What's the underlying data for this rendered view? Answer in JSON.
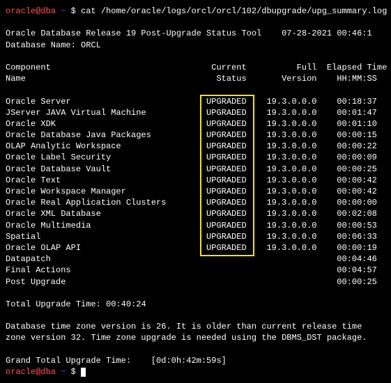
{
  "prompt": {
    "user": "oracle@dba",
    "tilde": "~",
    "dollar": "$",
    "command": "cat /home/oracle/logs/orcl/orcl/102/dbupgrade/upg_summary.log"
  },
  "header_line1_left": "Oracle Database Release 19 Post-Upgrade Status Tool",
  "header_line1_right": "07-28-2021 00:46:1",
  "db_name_label": "Database Name: ORCL",
  "col": {
    "c1a": "Component",
    "c1b": "Name",
    "c2a": "Current",
    "c2b": "Status",
    "c3a": "Full",
    "c3b": "Version",
    "c4a": "Elapsed Time",
    "c4b": "HH:MM:SS"
  },
  "rows": [
    {
      "name": "Oracle Server",
      "status": "UPGRADED",
      "ver": "19.3.0.0.0",
      "time": "00:18:37"
    },
    {
      "name": "JServer JAVA Virtual Machine",
      "status": "UPGRADED",
      "ver": "19.3.0.0.0",
      "time": "00:01:47"
    },
    {
      "name": "Oracle XDK",
      "status": "UPGRADED",
      "ver": "19.3.0.0.0",
      "time": "00:01:10"
    },
    {
      "name": "Oracle Database Java Packages",
      "status": "UPGRADED",
      "ver": "19.3.0.0.0",
      "time": "00:00:15"
    },
    {
      "name": "OLAP Analytic Workspace",
      "status": "UPGRADED",
      "ver": "19.3.0.0.0",
      "time": "00:00:22"
    },
    {
      "name": "Oracle Label Security",
      "status": "UPGRADED",
      "ver": "19.3.0.0.0",
      "time": "00:00:09"
    },
    {
      "name": "Oracle Database Vault",
      "status": "UPGRADED",
      "ver": "19.3.0.0.0",
      "time": "00:00:25"
    },
    {
      "name": "Oracle Text",
      "status": "UPGRADED",
      "ver": "19.3.0.0.0",
      "time": "00:00:42"
    },
    {
      "name": "Oracle Workspace Manager",
      "status": "UPGRADED",
      "ver": "19.3.0.0.0",
      "time": "00:00:42"
    },
    {
      "name": "Oracle Real Application Clusters",
      "status": "UPGRADED",
      "ver": "19.3.0.0.0",
      "time": "00:00:00"
    },
    {
      "name": "Oracle XML Database",
      "status": "UPGRADED",
      "ver": "19.3.0.0.0",
      "time": "00:02:08"
    },
    {
      "name": "Oracle Multimedia",
      "status": "UPGRADED",
      "ver": "19.3.0.0.0",
      "time": "00:00:53"
    },
    {
      "name": "Spatial",
      "status": "UPGRADED",
      "ver": "19.3.0.0.0",
      "time": "00:06:33"
    },
    {
      "name": "Oracle OLAP API",
      "status": "UPGRADED",
      "ver": "19.3.0.0.0",
      "time": "00:00:19"
    },
    {
      "name": "Datapatch",
      "status": "",
      "ver": "",
      "time": "00:04:46"
    },
    {
      "name": "Final Actions",
      "status": "",
      "ver": "",
      "time": "00:04:57"
    },
    {
      "name": "Post Upgrade",
      "status": "",
      "ver": "",
      "time": "00:00:25"
    }
  ],
  "total_upgrade": "Total Upgrade Time: 00:40:24",
  "tz_line1": "Database time zone version is 26. It is older than current release time",
  "tz_line2": "zone version 32. Time zone upgrade is needed using the DBMS_DST package.",
  "grand_total_label": "Grand Total Upgrade Time:",
  "grand_total_value": "[0d:0h:42m:59s]"
}
